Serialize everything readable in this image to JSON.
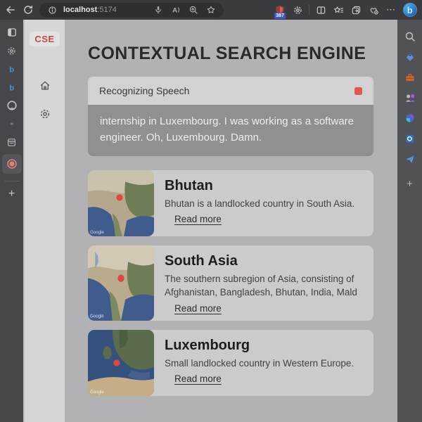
{
  "browser": {
    "url_host": "localhost",
    "url_port": ":5174",
    "extension_badge": "387"
  },
  "glyphs": {
    "more": "⋯",
    "new_tab": "+",
    "customize": "+",
    "bing_b": "b",
    "bing_tab_b": "b",
    "read_aloud_a": "A"
  },
  "app": {
    "logo": "CSE",
    "title": "CONTEXTUAL SEARCH ENGINE",
    "speech": {
      "status": "Recognizing Speech",
      "transcript": "internship in Luxembourg. I was working as a software engineer. Oh, Luxembourg. Damn."
    },
    "cards": [
      {
        "title": "Bhutan",
        "description": "Bhutan is a landlocked country in South Asia.",
        "link": "Read more",
        "map_watermark": "Google"
      },
      {
        "title": "South Asia",
        "description": "The southern subregion of Asia, consisting of Afghanistan, Bangladesh, Bhutan, India, Mald",
        "link": "Read more",
        "map_watermark": "Google"
      },
      {
        "title": "Luxembourg",
        "description": "Small landlocked country in Western Europe.",
        "link": "Read more",
        "map_watermark": "Google"
      }
    ]
  },
  "colors": {
    "accent_red": "#c64a42",
    "stop_button": "#dc5a52",
    "map_marker": "#e2473b",
    "badge_bg": "#3d55c8"
  }
}
